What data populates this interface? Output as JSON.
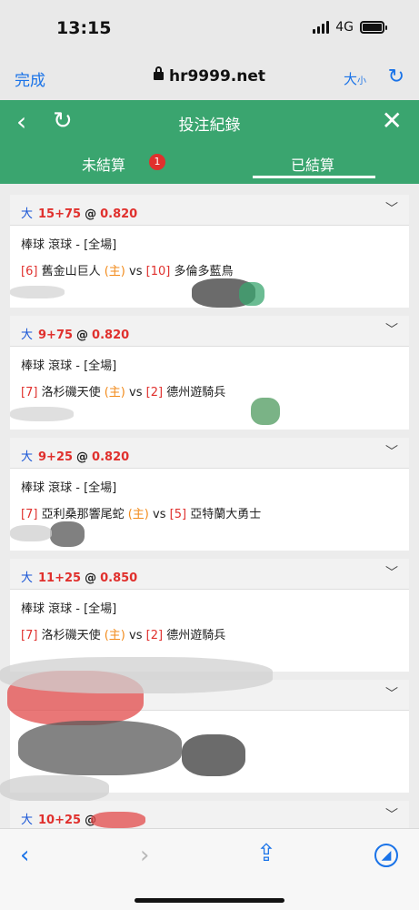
{
  "status_bar": {
    "time": "13:15",
    "network": "4G"
  },
  "browser": {
    "done_label": "完成",
    "url": "hr9999.net",
    "text_size_big": "大",
    "text_size_small": "小"
  },
  "header": {
    "title": "投注紀錄"
  },
  "tabs": {
    "unsettled_label": "未結算",
    "unsettled_count": "1",
    "settled_label": "已結算"
  },
  "bets": [
    {
      "ou": "大",
      "line": "15+75",
      "at": "@",
      "odds": "0.820",
      "sport": "棒球 滾球 - [全場]",
      "home_rank": "[6]",
      "home_team": "舊金山巨人",
      "home_tag": "(主)",
      "vs": "vs",
      "away_rank": "[10]",
      "away_team": "多倫多藍鳥"
    },
    {
      "ou": "大",
      "line": "9+75",
      "at": "@",
      "odds": "0.820",
      "sport": "棒球 滾球 - [全場]",
      "home_rank": "[7]",
      "home_team": "洛杉磯天使",
      "home_tag": "(主)",
      "vs": "vs",
      "away_rank": "[2]",
      "away_team": "德州遊騎兵"
    },
    {
      "ou": "大",
      "line": "9+25",
      "at": "@",
      "odds": "0.820",
      "sport": "棒球 滾球 - [全場]",
      "home_rank": "[7]",
      "home_team": "亞利桑那響尾蛇",
      "home_tag": "(主)",
      "vs": "vs",
      "away_rank": "[5]",
      "away_team": "亞特蘭大勇士"
    },
    {
      "ou": "大",
      "line": "11+25",
      "at": "@",
      "odds": "0.850",
      "sport": "棒球 滾球 - [全場]",
      "home_rank": "[7]",
      "home_team": "洛杉磯天使",
      "home_tag": "(主)",
      "vs": "vs",
      "away_rank": "[2]",
      "away_team": "德州遊騎兵"
    },
    {
      "ou": "",
      "line": "",
      "at": "",
      "odds": "",
      "sport": "",
      "home_rank": "",
      "home_team": "",
      "home_tag": "",
      "vs": "",
      "away_rank": "",
      "away_team": ""
    },
    {
      "ou": "大",
      "line": "10+25",
      "at": "@",
      "odds": "",
      "sport": "",
      "home_rank": "",
      "home_team": "",
      "home_tag": "",
      "vs": "",
      "away_rank": "",
      "away_team": ""
    }
  ],
  "colors": {
    "header_green": "#3aa56f",
    "ios_blue": "#1a73e8",
    "odds_red": "#e0302d",
    "home_orange": "#f28a1a",
    "ou_blue": "#1a56d6"
  }
}
